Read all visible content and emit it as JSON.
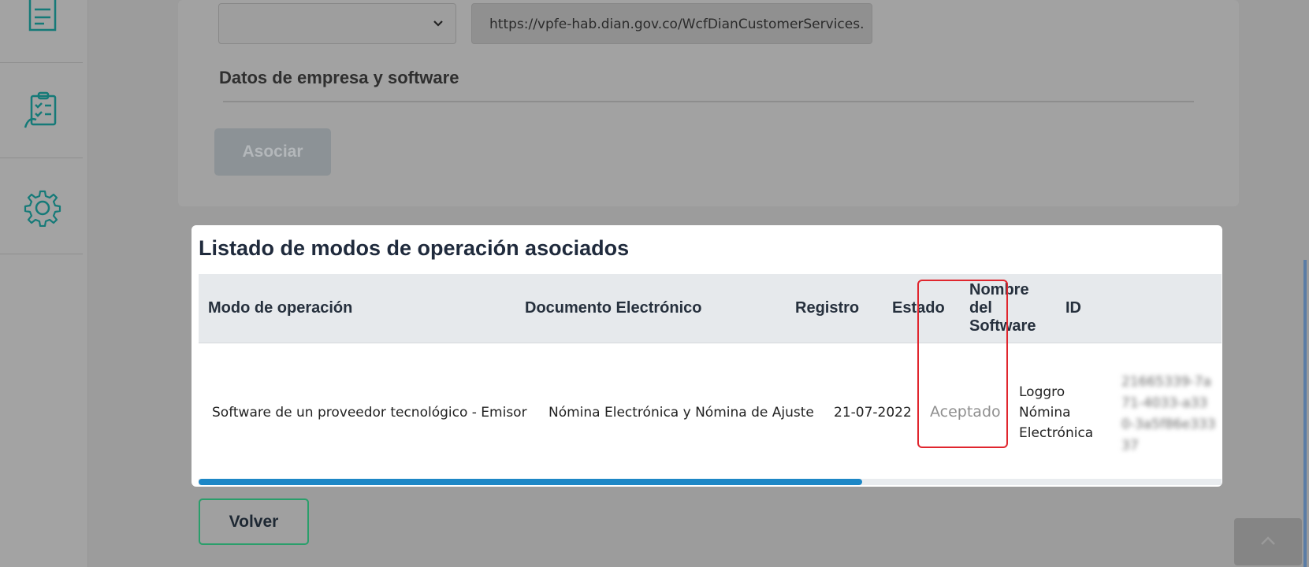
{
  "sidebar": {
    "icons": [
      "document-icon",
      "clipboard-checklist-icon",
      "gear-icon"
    ]
  },
  "form": {
    "url_value": "https://vpfe-hab.dian.gov.co/WcfDianCustomerServices.",
    "section_title": "Datos de empresa y software",
    "asociar_label": "Asociar"
  },
  "card": {
    "title": "Listado de modos de operación asociados",
    "headers": {
      "modo": "Modo de operación",
      "documento": "Documento Electrónico",
      "registro": "Registro",
      "estado": "Estado",
      "nombre": "Nombre del Software",
      "id": "ID"
    },
    "rows": [
      {
        "modo": "Software de un proveedor tecnológico - Emisor",
        "documento": "Nómina Electrónica y Nómina de Ajuste",
        "registro": "21-07-2022",
        "estado": "Aceptado",
        "nombre": "Loggro Nómina Electrónica",
        "id": "21665339-7a71-4033-a330-3a5f86e33337"
      }
    ]
  },
  "footer": {
    "volver_label": "Volver"
  },
  "colors": {
    "accent_green": "#2a9e6b",
    "scroll_blue": "#1d87c6",
    "highlight_red": "#e0262e"
  }
}
